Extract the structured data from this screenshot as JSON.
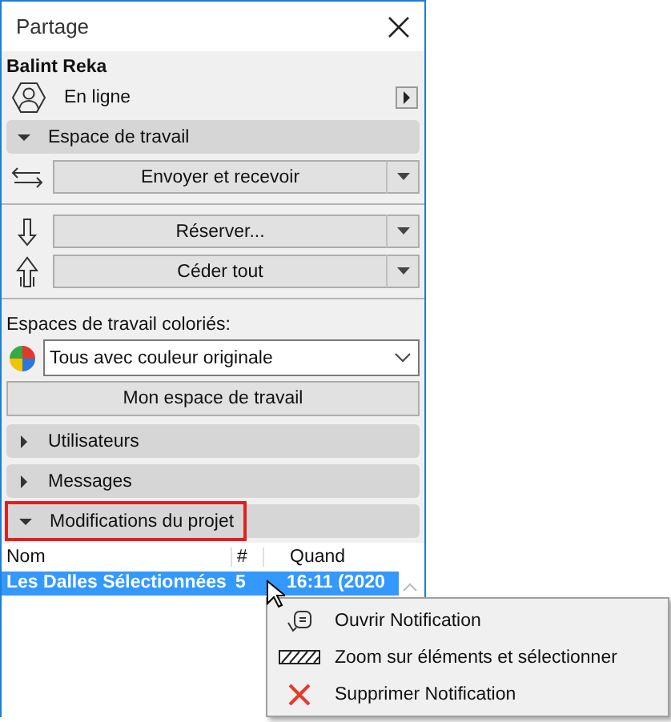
{
  "panel": {
    "title": "Partage"
  },
  "user": {
    "name": "Balint Reka",
    "status": "En ligne"
  },
  "workspace": {
    "header": "Espace de travail",
    "expanded": true,
    "send_button": "Envoyer et recevoir",
    "reserve_button": "Réserver...",
    "release_button": "Céder tout"
  },
  "colored": {
    "label": "Espaces de travail coloriés:",
    "value": "Tous avec couleur originale",
    "button": "Mon espace de travail"
  },
  "sections": [
    {
      "label": "Utilisateurs",
      "expanded": false,
      "highlighted": false
    },
    {
      "label": "Messages",
      "expanded": false,
      "highlighted": false
    },
    {
      "label": "Modifications du projet",
      "expanded": true,
      "highlighted": true
    }
  ],
  "table": {
    "columns": [
      "Nom",
      "#",
      "Quand"
    ],
    "rows": [
      {
        "cells": [
          "Les Dalles Sélectionnées",
          "5",
          "16:11 (2020"
        ],
        "selected": true
      }
    ]
  },
  "context_menu": {
    "items": [
      {
        "kind": "open",
        "label": "Ouvrir Notification"
      },
      {
        "kind": "zoom",
        "label": "Zoom sur éléments et sélectionner"
      },
      {
        "kind": "delete",
        "label": "Supprimer Notification"
      }
    ]
  }
}
